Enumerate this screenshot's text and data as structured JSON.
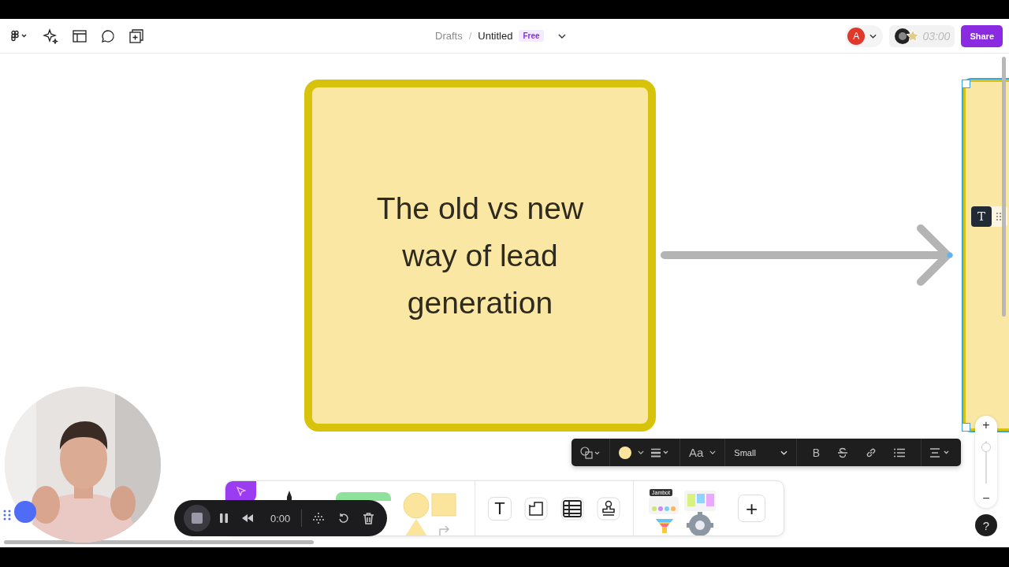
{
  "breadcrumb": {
    "folder": "Drafts",
    "separator": "/",
    "file": "Untitled",
    "badge": "Free"
  },
  "avatar": {
    "initial": "A",
    "color": "#e0382b"
  },
  "timer": "03:00",
  "share": "Share",
  "sticky": {
    "text": "The old vs new way of lead generation"
  },
  "text_popup": {
    "glyph": "T"
  },
  "text_toolbar": {
    "font": "Aa",
    "size": "Small",
    "bold": "B"
  },
  "tools": {
    "text": "T",
    "add": "+"
  },
  "jambot": "Jambot",
  "recorder": {
    "time": "0:00"
  },
  "zoom": {
    "plus": "+",
    "minus": "−",
    "level": 0.95
  },
  "help": "?"
}
